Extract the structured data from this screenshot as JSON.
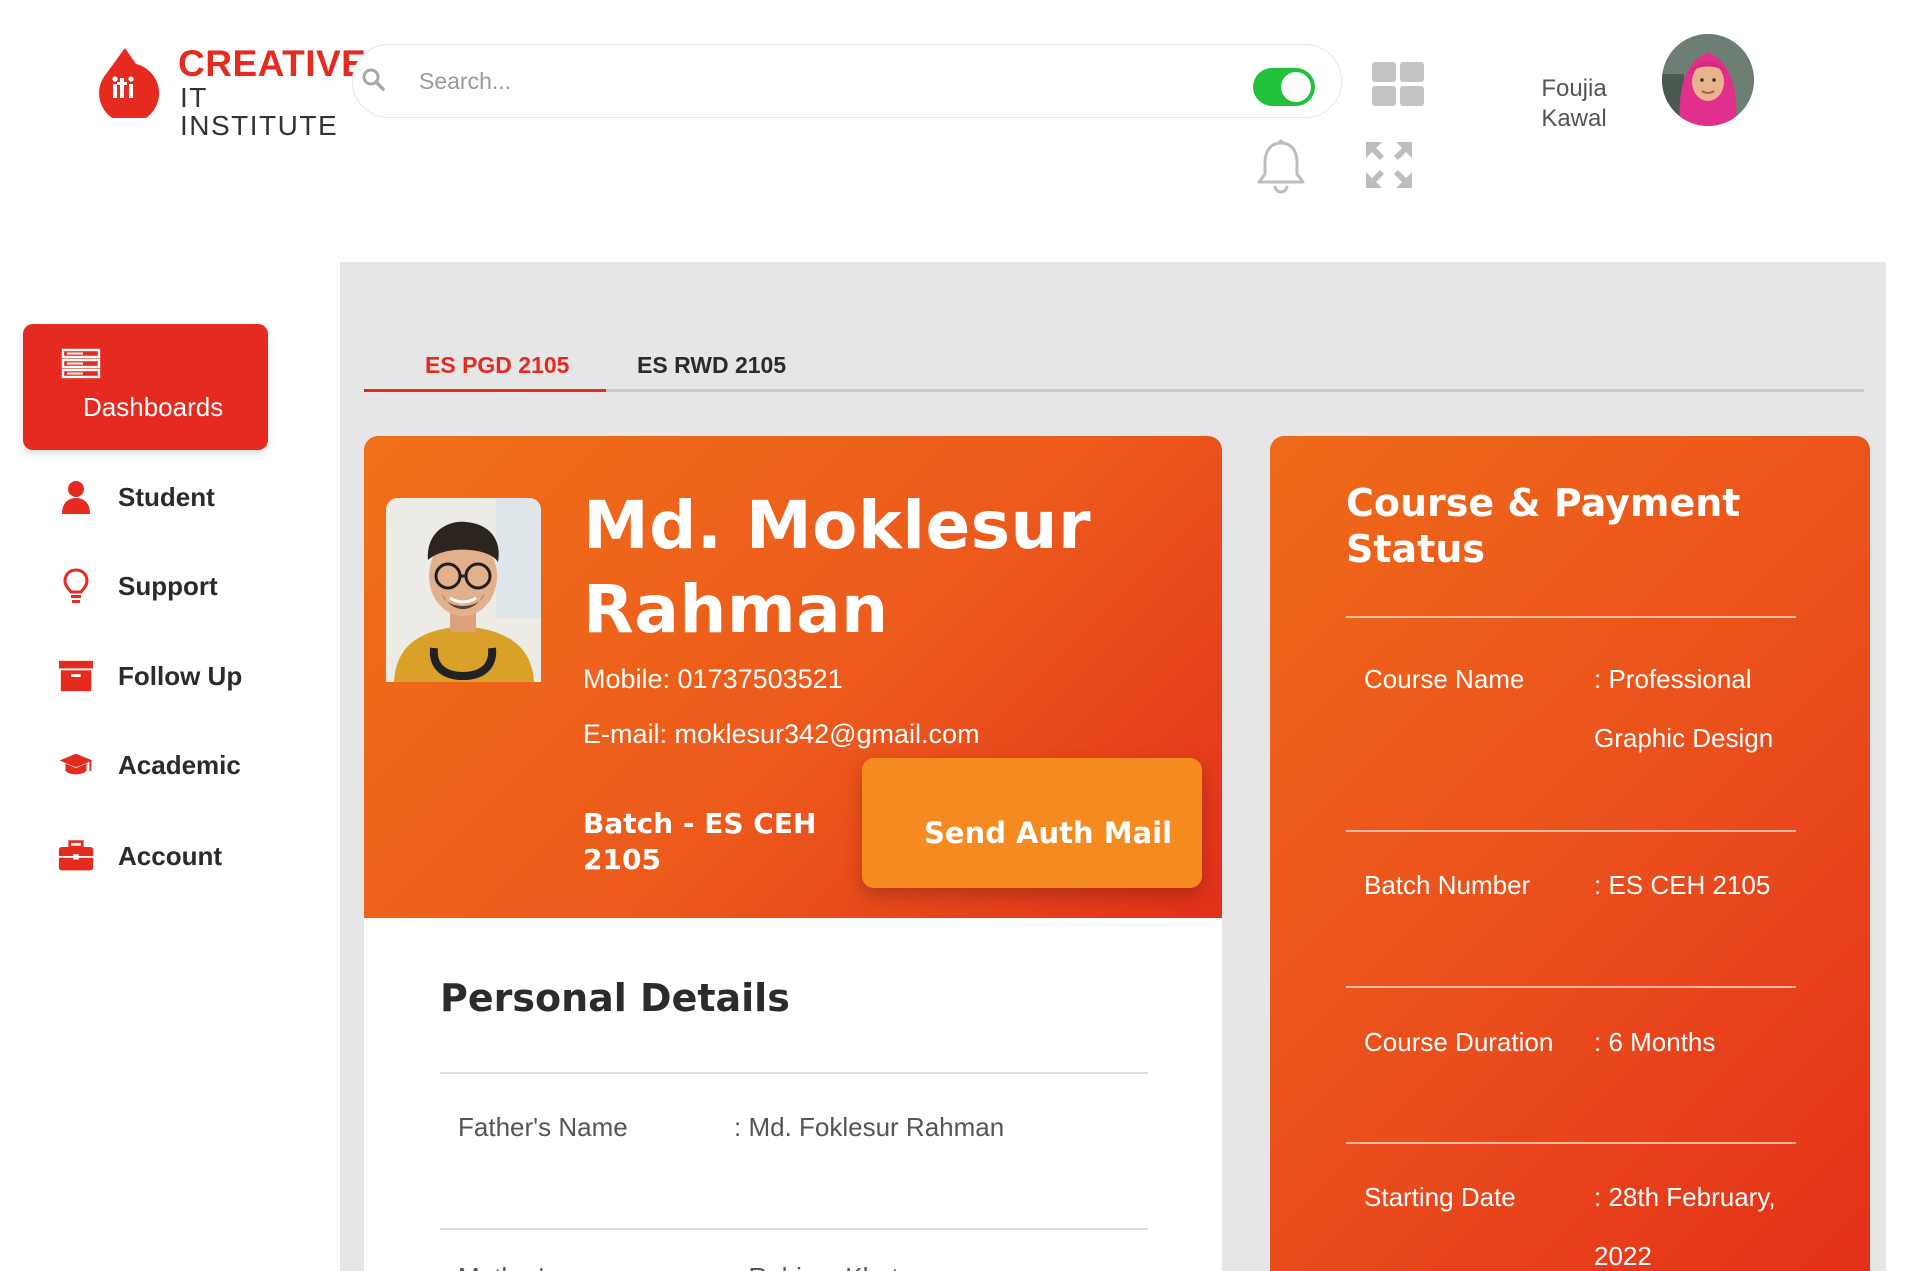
{
  "header": {
    "logo_line1": "CREATIVE",
    "logo_line2": "IT INSTITUTE",
    "search_placeholder": "Search...",
    "user_name": "Foujia Kawal"
  },
  "sidebar": {
    "items": [
      {
        "label": "Dashboards",
        "icon": "server-icon",
        "active": true
      },
      {
        "label": "Student",
        "icon": "user-icon"
      },
      {
        "label": "Support",
        "icon": "lightbulb-icon"
      },
      {
        "label": "Follow Up",
        "icon": "archive-box-icon"
      },
      {
        "label": "Academic",
        "icon": "graduation-cap-icon"
      },
      {
        "label": "Account",
        "icon": "briefcase-icon"
      }
    ]
  },
  "tabs": [
    {
      "label": "ES PGD 2105",
      "active": true
    },
    {
      "label": "ES RWD 2105",
      "active": false
    }
  ],
  "profile": {
    "name": "Md. Moklesur Rahman",
    "mobile": "Mobile: 01737503521",
    "email": "E-mail: moklesur342@gmail.com",
    "batch": "Batch - ES CEH 2105",
    "auth_button": "Send Auth Mail"
  },
  "personal_details": {
    "title": "Personal Details",
    "rows": [
      {
        "label": "Father's Name",
        "value": ": Md. Foklesur Rahman"
      },
      {
        "label": "Mother's",
        "value": ": Rahima Khatun"
      }
    ]
  },
  "course_status": {
    "title": "Course & Payment Status",
    "rows": [
      {
        "label": "Course Name",
        "value": ": Professional Graphic Design"
      },
      {
        "label": "Batch Number",
        "value": ": ES CEH 2105"
      },
      {
        "label": "Course Duration",
        "value": ": 6 Months"
      },
      {
        "label": "Starting Date",
        "value": ": 28th February, 2022"
      }
    ]
  },
  "colors": {
    "brand_red": "#e52b1f",
    "card_orange": "#f07019",
    "button_orange": "#f58a20",
    "toggle_green": "#1fc23a",
    "panel_gray": "#e6e6e6"
  }
}
